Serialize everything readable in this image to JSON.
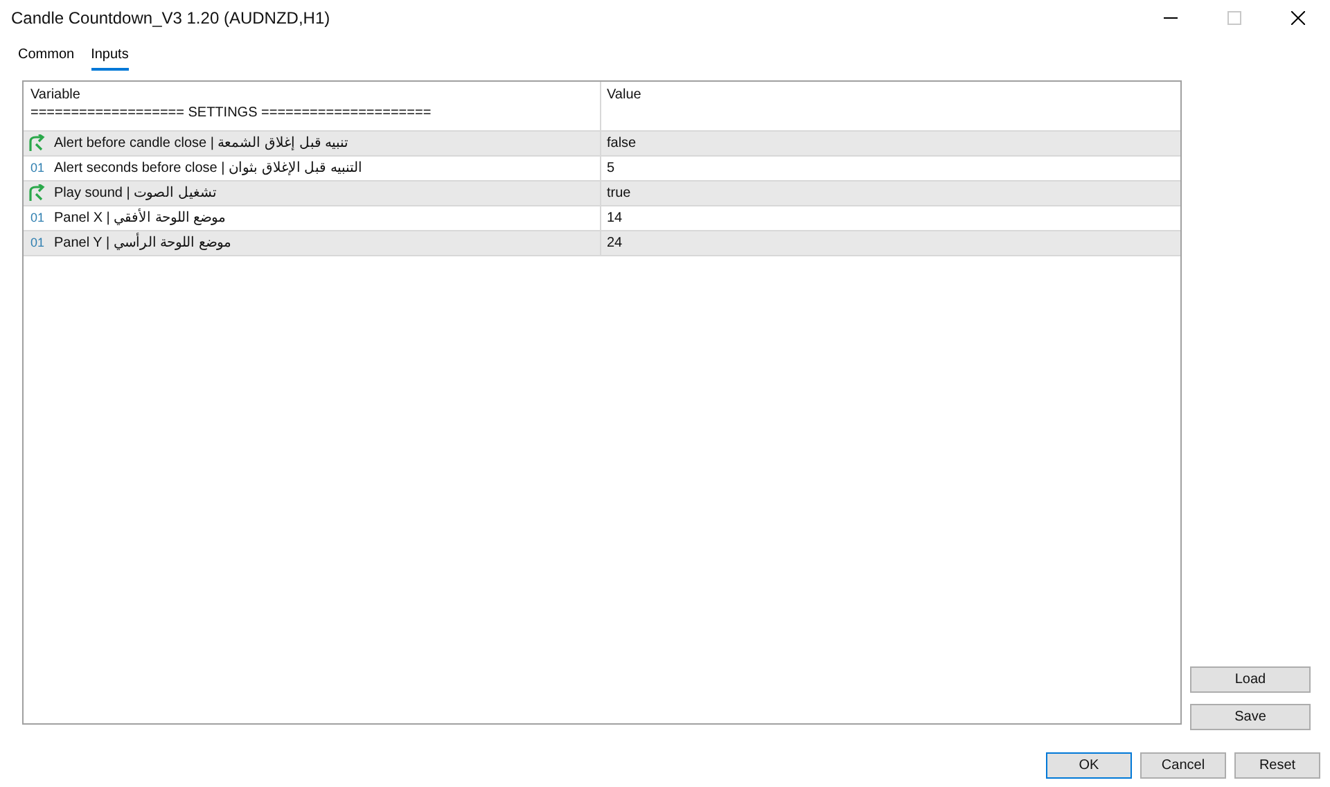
{
  "window": {
    "title": "Candle Countdown_V3 1.20 (AUDNZD,H1)",
    "maximize_disabled": true
  },
  "tabs": [
    {
      "label": "Common",
      "selected": false
    },
    {
      "label": "Inputs",
      "selected": true
    }
  ],
  "table": {
    "columns": [
      "Variable",
      "Value"
    ],
    "section": "=================== SETTINGS =====================",
    "rows": [
      {
        "kind": "bool",
        "variable": "Alert before candle close | تنبيه قبل إغلاق الشمعة",
        "value": "false"
      },
      {
        "kind": "int",
        "icon_text": "01",
        "variable": "Alert seconds before close | التنبيه قبل الإغلاق بثوان",
        "value": "5"
      },
      {
        "kind": "bool",
        "variable": "Play sound | تشغيل الصوت",
        "value": "true"
      },
      {
        "kind": "int",
        "icon_text": "01",
        "variable": "Panel X | موضع اللوحة الأفقي",
        "value": "14"
      },
      {
        "kind": "int",
        "icon_text": "01",
        "variable": "Panel Y | موضع اللوحة الرأسي",
        "value": "24"
      }
    ]
  },
  "side_buttons": [
    "Load",
    "Save"
  ],
  "footer_buttons": [
    {
      "label": "OK",
      "default": true
    },
    {
      "label": "Cancel",
      "default": false
    },
    {
      "label": "Reset",
      "default": false
    }
  ]
}
